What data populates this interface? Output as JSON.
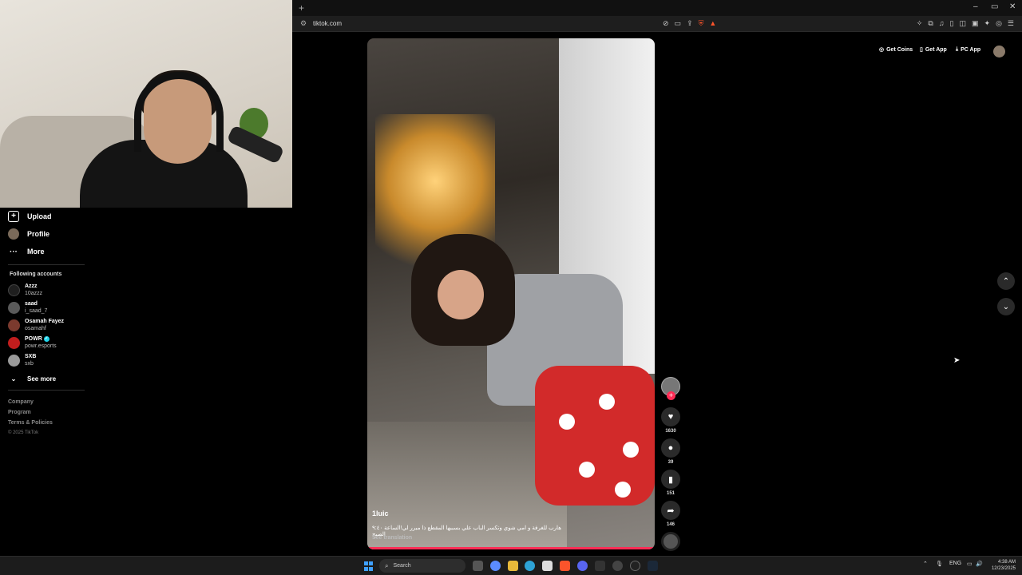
{
  "browser": {
    "url": "tiktok.com",
    "new_tab_symbol": "+",
    "win_min": "–",
    "win_restore": "▭",
    "win_close": "✕"
  },
  "sidebar": {
    "nav": [
      {
        "label": "Upload",
        "icon": "upload-icon"
      },
      {
        "label": "Profile",
        "icon": "avatar"
      },
      {
        "label": "More",
        "icon": "more-icon"
      }
    ],
    "following_title": "Following accounts",
    "accounts": [
      {
        "name": "Azzz",
        "username": "10azzz",
        "color": "#1f1f1f",
        "verified": false
      },
      {
        "name": "saad",
        "username": "i_saad_7",
        "color": "#5a5a5a",
        "verified": false
      },
      {
        "name": "Osamah Fayez",
        "username": "osamahf",
        "color": "#7b3a2e",
        "verified": false
      },
      {
        "name": "POWR",
        "username": "powr.esports",
        "color": "#c21d1d",
        "verified": true
      },
      {
        "name": "SXB",
        "username": "sxb",
        "color": "#9a9a9a",
        "verified": false
      }
    ],
    "see_more": "See more",
    "footer": [
      "Company",
      "Program",
      "Terms & Policies"
    ],
    "copyright": "© 2025 TikTok"
  },
  "video": {
    "author": "1luic",
    "caption": "هارب للغرفة و امي شوي وتكسر الباب علي بسببها المقطع ذا مبرر لي!الساعة ٩:٤٠ الصبح",
    "see_translation": "See translation"
  },
  "actions": {
    "likes": "1630",
    "comments": "39",
    "saves": "151",
    "shares": "146"
  },
  "header": {
    "get_coins": "Get Coins",
    "get_app": "Get App",
    "pc_app": "PC App"
  },
  "taskbar": {
    "search_placeholder": "Search",
    "lang": "ENG",
    "time": "4:38 AM",
    "date": "12/23/2025"
  },
  "colors": {
    "accent": "#fe2c55",
    "verified": "#20d5ec"
  }
}
